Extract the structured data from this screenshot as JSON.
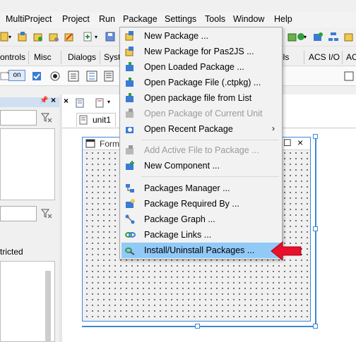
{
  "menubar": {
    "items": [
      "MultiProject",
      "Project",
      "Run",
      "Package",
      "Settings",
      "Tools",
      "Window",
      "Help"
    ]
  },
  "palette": {
    "tabs": [
      "ontrols",
      "Misc",
      "Dialogs",
      "Syst",
      "ntrols",
      "ACS I/O",
      "AC"
    ],
    "on_label": "on"
  },
  "editor": {
    "unit_tab": "unit1",
    "form_title": "Form"
  },
  "left_panel": {
    "label": "tricted"
  },
  "package_menu": {
    "items": [
      {
        "label": "New Package ...",
        "enabled": true,
        "icon": "new-package-icon"
      },
      {
        "label": "New Package for Pas2JS ...",
        "enabled": true,
        "icon": "pas2js-package-icon"
      },
      {
        "label": "Open Loaded Package ...",
        "enabled": true,
        "icon": "open-loaded-package-icon"
      },
      {
        "label": "Open Package File (.ctpkg) ...",
        "enabled": true,
        "icon": "open-package-file-icon"
      },
      {
        "label": "Open package file from List",
        "enabled": true,
        "icon": "open-from-list-icon"
      },
      {
        "label": "Open Package of Current Unit",
        "enabled": false,
        "icon": "package-current-unit-icon"
      },
      {
        "label": "Open Recent Package",
        "enabled": true,
        "icon": "recent-package-icon",
        "submenu": true
      },
      {
        "label": "Add Active File to Package ...",
        "enabled": false,
        "icon": "add-file-icon"
      },
      {
        "label": "New Component ...",
        "enabled": true,
        "icon": "new-component-icon"
      },
      {
        "label": "Packages Manager ...",
        "enabled": true,
        "icon": "packages-manager-icon"
      },
      {
        "label": "Package Required By ...",
        "enabled": true,
        "icon": "package-required-icon"
      },
      {
        "label": "Package Graph ...",
        "enabled": true,
        "icon": "package-graph-icon"
      },
      {
        "label": "Package Links ...",
        "enabled": true,
        "icon": "package-links-icon"
      },
      {
        "label": "Install/Uninstall Packages ...",
        "enabled": true,
        "icon": "install-packages-icon",
        "highlighted": true
      }
    ],
    "submenu_arrow": "›"
  },
  "colors": {
    "highlight": "#91c9f7",
    "arrow": "#e8102a",
    "selection": "#3d87d9"
  }
}
